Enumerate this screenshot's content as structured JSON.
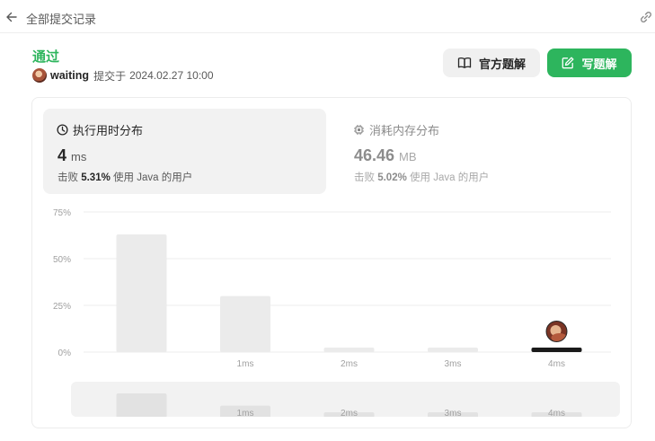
{
  "header": {
    "back_label": "全部提交记录"
  },
  "submission": {
    "status": "通过",
    "user": "waiting",
    "submitted_label": "提交于",
    "time": "2024.02.27 10:00"
  },
  "actions": {
    "official_solution": "官方题解",
    "write_solution": "写题解"
  },
  "runtime": {
    "title": "执行用时分布",
    "value": "4",
    "unit": "ms",
    "beat_prefix": "击败",
    "beat_percent": "5.31%",
    "beat_suffix": "使用 Java 的用户"
  },
  "memory": {
    "title": "消耗内存分布",
    "value": "46.46",
    "unit": "MB",
    "beat_prefix": "击败",
    "beat_percent": "5.02%",
    "beat_suffix": "使用 Java 的用户"
  },
  "colors": {
    "accent": "#2db55d",
    "bar": "#ebebeb",
    "selected_bar": "#1a1a1a"
  },
  "icons": {
    "back": "arrow-left-icon",
    "link": "link-icon",
    "book": "book-icon",
    "edit": "edit-icon",
    "clock": "clock-icon",
    "chip": "chip-icon"
  },
  "chart_data": {
    "type": "bar",
    "categories": [
      "",
      "1ms",
      "2ms",
      "3ms",
      "4ms"
    ],
    "values": [
      63,
      30,
      2,
      2,
      2
    ],
    "ylim": [
      0,
      75
    ],
    "yticks": [
      "75%",
      "50%",
      "25%",
      "0%"
    ],
    "selected_index": 4,
    "grid": true
  }
}
